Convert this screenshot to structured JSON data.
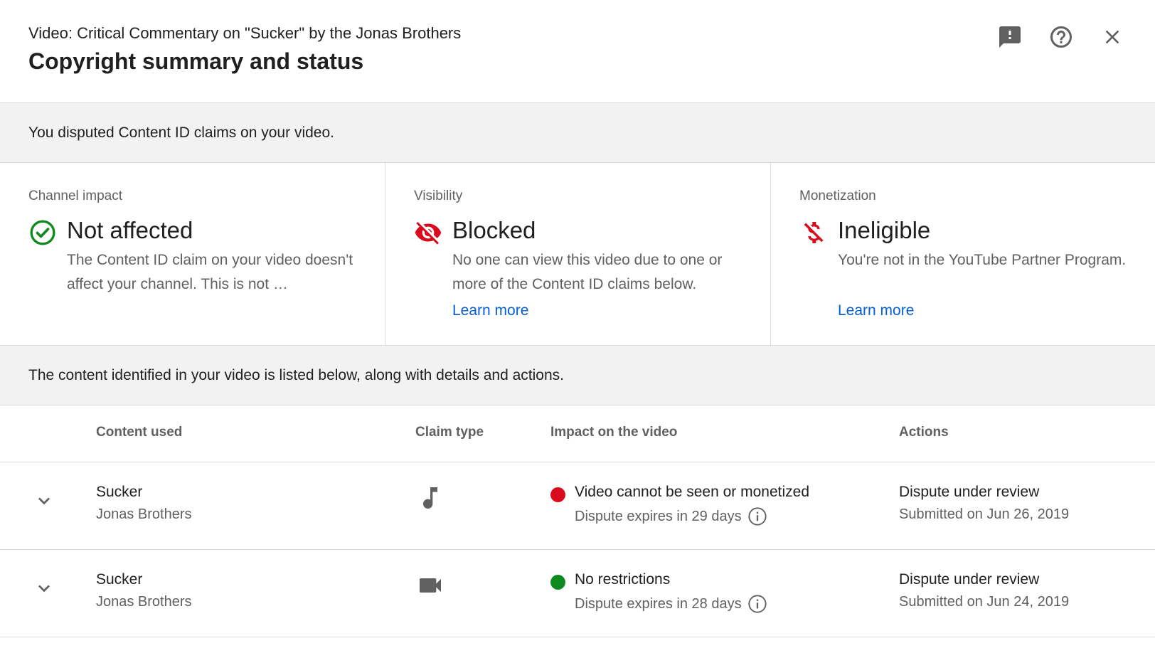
{
  "header": {
    "subtitle": "Video: Critical Commentary on \"Sucker\" by the Jonas Brothers",
    "title": "Copyright summary and status",
    "icons": [
      "feedback-icon",
      "help-icon",
      "close-icon"
    ]
  },
  "banner_dispute": "You disputed Content ID claims on your video.",
  "cards": [
    {
      "label": "Channel impact",
      "status": "Not affected",
      "icon": "check-circle-icon",
      "description": "The Content ID claim on your video doesn't affect your channel. This is not …",
      "link": ""
    },
    {
      "label": "Visibility",
      "status": "Blocked",
      "icon": "eye-off-icon",
      "description": "No one can view this video due to one or more of the Content ID claims below.",
      "link": "Learn more"
    },
    {
      "label": "Monetization",
      "status": "Ineligible",
      "icon": "dollar-off-icon",
      "description": "You're not in the YouTube Partner Program.",
      "link": "Learn more"
    }
  ],
  "banner_content": "The content identified in your video is listed below, along with details and actions.",
  "table": {
    "headers": {
      "content": "Content used",
      "claim_type": "Claim type",
      "impact": "Impact on the video",
      "actions": "Actions"
    },
    "rows": [
      {
        "title": "Sucker",
        "artist": "Jonas Brothers",
        "claim_icon": "music-note-icon",
        "impact_color": "#d90b1c",
        "impact": "Video cannot be seen or monetized",
        "expires": "Dispute expires in 29 days",
        "action": "Dispute under review",
        "submitted": "Submitted on Jun 26, 2019"
      },
      {
        "title": "Sucker",
        "artist": "Jonas Brothers",
        "claim_icon": "video-camera-icon",
        "impact_color": "#0f8a1e",
        "impact": "No restrictions",
        "expires": "Dispute expires in 28 days",
        "action": "Dispute under review",
        "submitted": "Submitted on Jun 24, 2019"
      }
    ]
  },
  "colors": {
    "link": "#065fd4",
    "ok": "#0f8a1e",
    "bad": "#d90b1c",
    "banner_bg": "#f2f2f2"
  }
}
